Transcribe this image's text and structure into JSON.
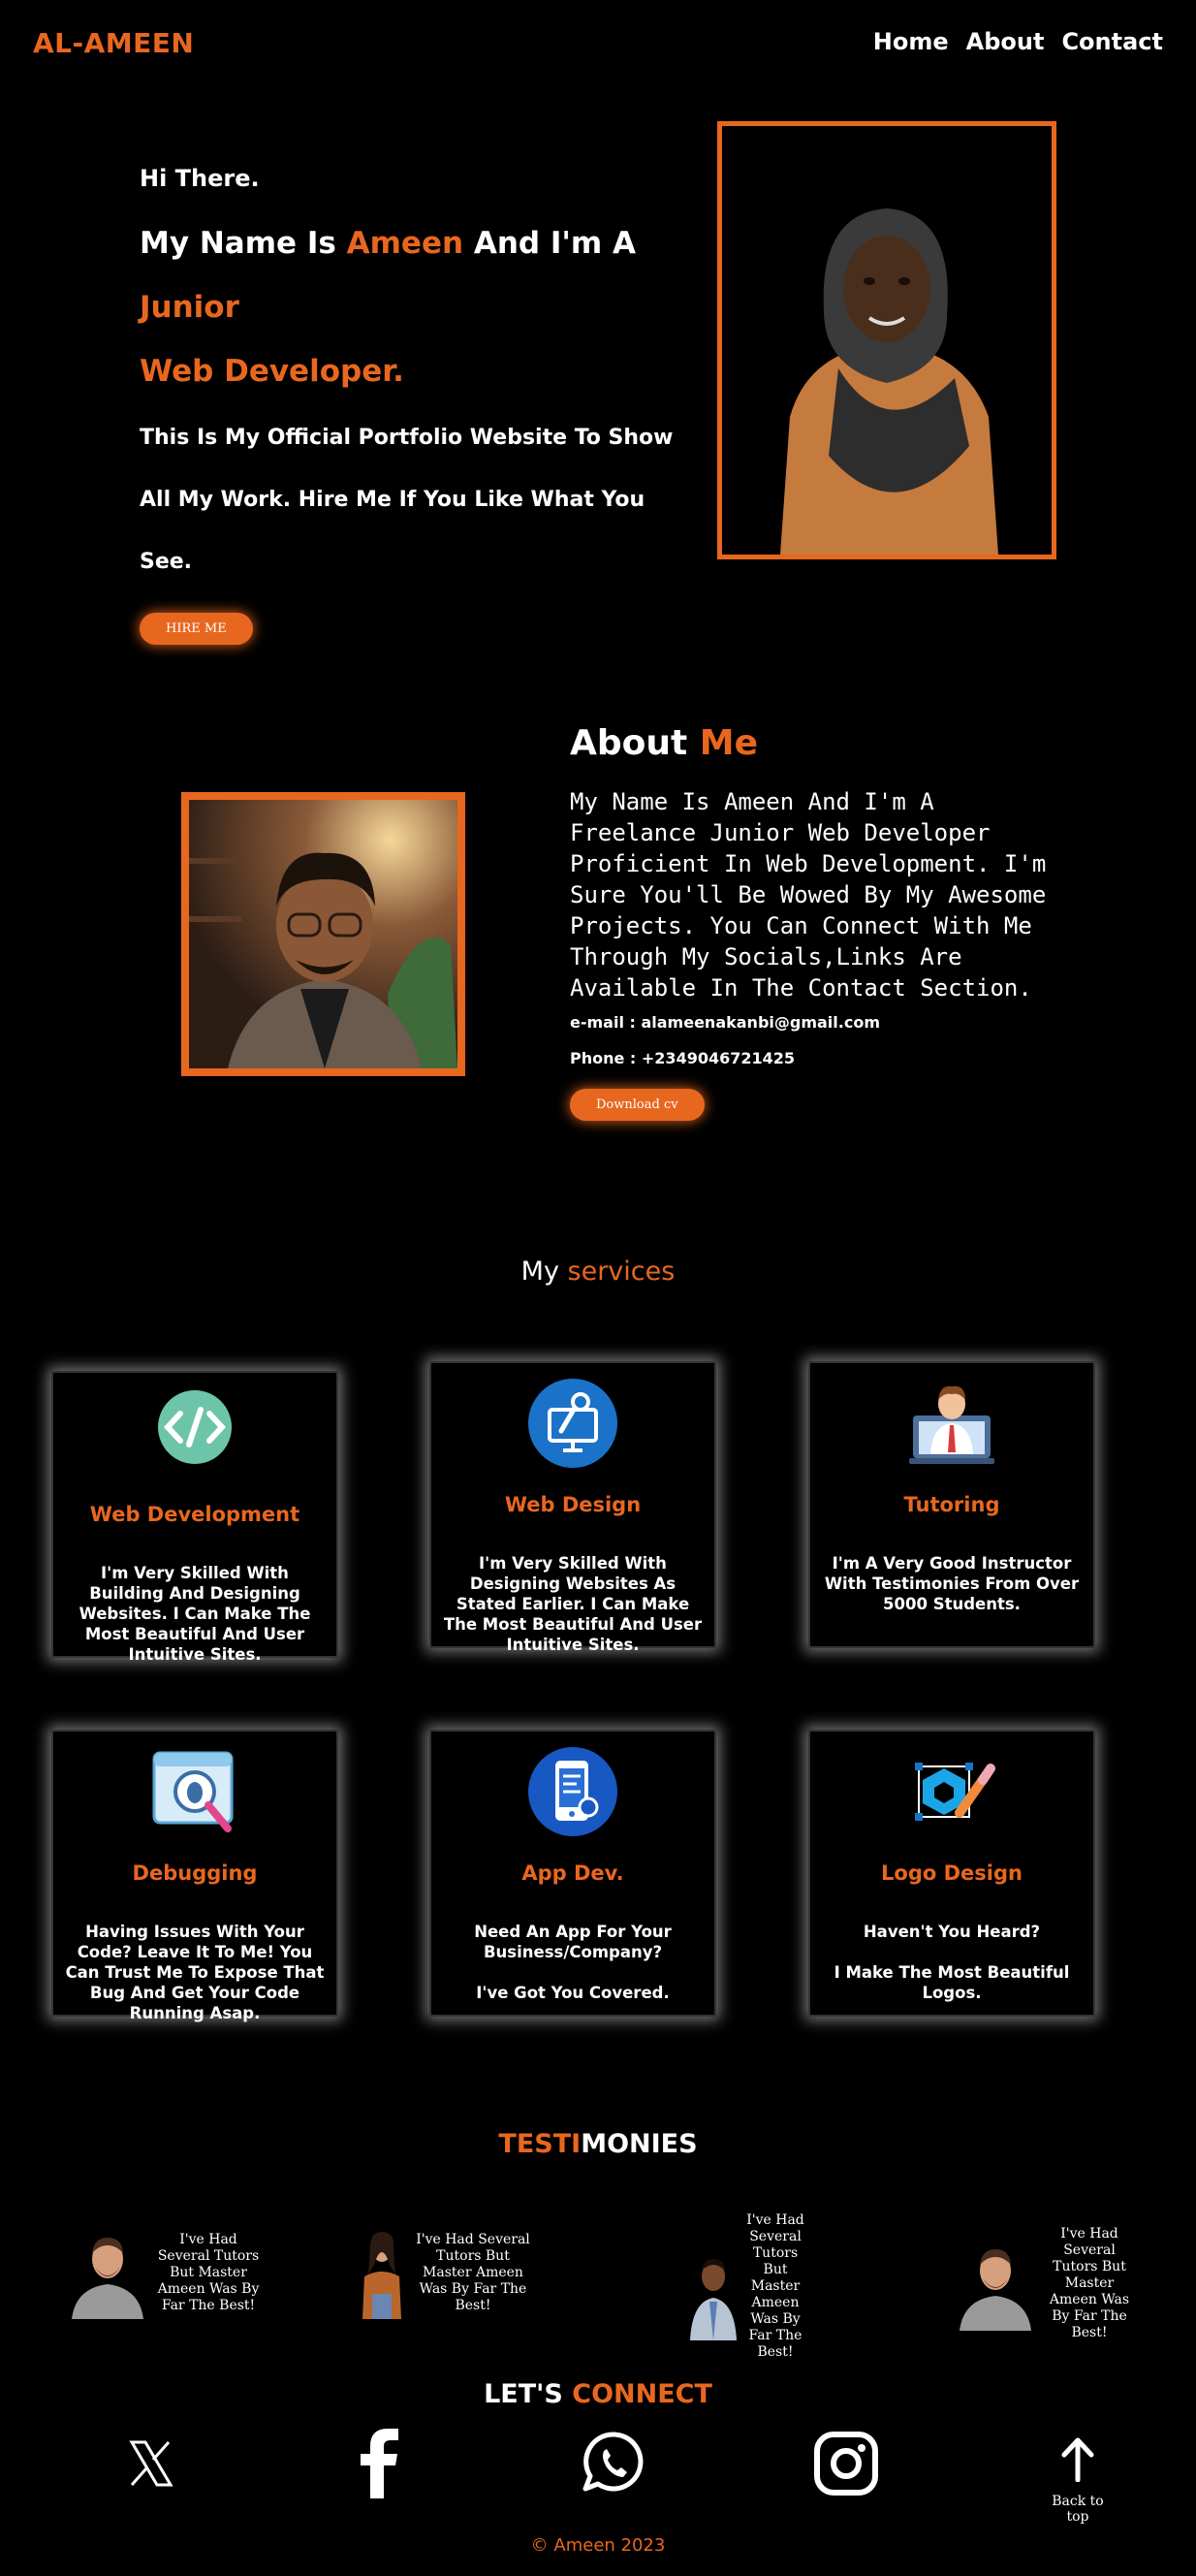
{
  "nav": {
    "logo": "AL-AMEEN",
    "links": [
      "Home",
      "About",
      "Contact"
    ]
  },
  "hero": {
    "greeting": "Hi There.",
    "name_prefix": "My Name Is",
    "name": "Ameen",
    "name_mid": "And I'm A",
    "role_line1": "Junior",
    "role_line2": "Web Developer.",
    "desc_line1": "This Is My Official Portfolio Website To Show",
    "desc_line2": "All My Work. Hire Me If You Like What You See.",
    "button": "HIRE ME"
  },
  "about": {
    "title_white": "About",
    "title_orange": "Me",
    "body": "My Name Is Ameen And I'm A Freelance Junior Web Developer Proficient In Web Development. I'm Sure You'll Be Wowed By My Awesome Projects. You Can Connect With Me Through My Socials,Links Are Available In The Contact Section.",
    "email": "e-mail : alameenakanbi@gmail.com",
    "phone": "Phone : +2349046721425",
    "button": "Download cv"
  },
  "services": {
    "title_white": "My",
    "title_orange": "services",
    "cards": [
      {
        "icon": "code-icon",
        "title": "Web Development",
        "desc": "I'm Very Skilled With Building And Designing Websites. I Can Make The Most Beautiful And User Intuitive Sites."
      },
      {
        "icon": "web-design-icon",
        "title": "Web Design",
        "desc": "I'm Very Skilled With Designing Websites As Stated Earlier. I Can Make The Most Beautiful And User Intuitive Sites."
      },
      {
        "icon": "tutor-icon",
        "title": "Tutoring",
        "desc": "I'm A Very Good Instructor With Testimonies From Over 5000 Students."
      },
      {
        "icon": "bug-icon",
        "title": "Debugging",
        "desc": "Having Issues With Your Code? Leave It To Me! You Can Trust Me To Expose That Bug And Get Your Code Running Asap."
      },
      {
        "icon": "mobile-app-icon",
        "title": "App Dev.",
        "desc": "Need An App For Your Business/Company?\n\nI've Got You Covered."
      },
      {
        "icon": "logo-design-icon",
        "title": "Logo Design",
        "desc": "Haven't You Heard?\n\nI Make The Most Beautiful Logos."
      }
    ]
  },
  "testimonies": {
    "title_orange": "TESTI",
    "title_white": "MONIES",
    "items": [
      {
        "text": "I've Had Several Tutors But Master Ameen Was By Far The Best!"
      },
      {
        "text": "I've Had Several Tutors But Master Ameen Was By Far The Best!"
      },
      {
        "text": "I've Had Several Tutors But Master Ameen Was By Far The Best!"
      },
      {
        "text": "I've Had Several Tutors But Master Ameen Was By Far The Best!"
      }
    ]
  },
  "connect": {
    "title_white": "LET'S",
    "title_orange": "CONNECT",
    "socials": [
      "x-icon",
      "facebook-icon",
      "whatsapp-icon",
      "instagram-icon"
    ],
    "back_to_top": "Back to top"
  },
  "footer": "© Ameen 2023",
  "colors": {
    "accent": "#e8671f",
    "background": "#000000",
    "text": "#ffffff"
  }
}
